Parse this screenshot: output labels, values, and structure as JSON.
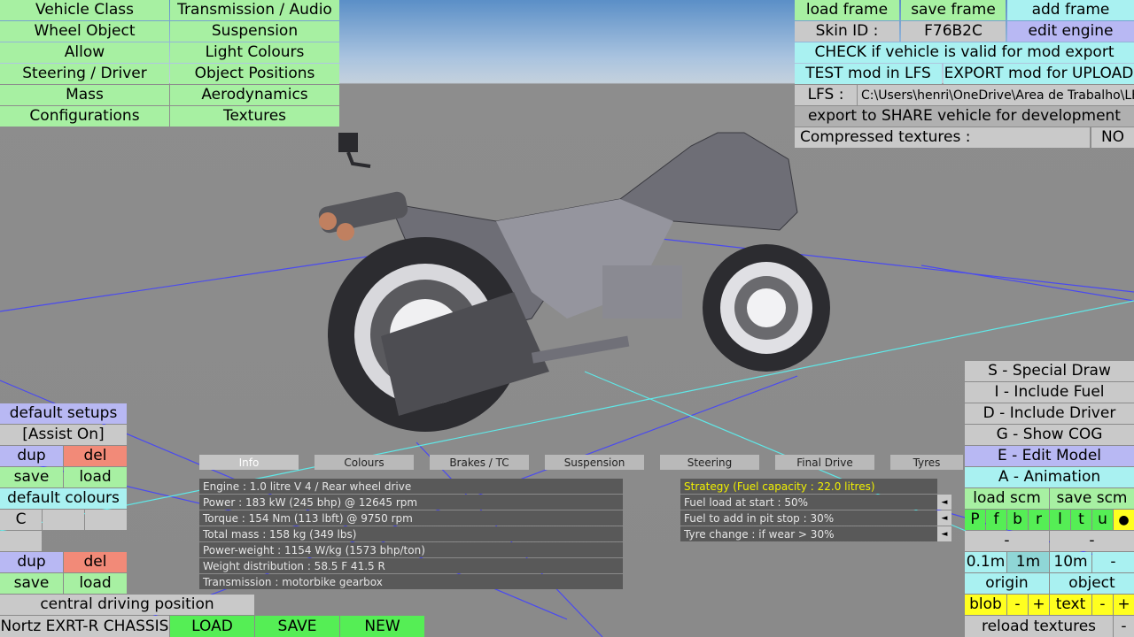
{
  "left_menu": {
    "col1": [
      "Vehicle Class",
      "Wheel Object",
      "Allow",
      "Steering / Driver",
      "Mass",
      "Configurations"
    ],
    "col2": [
      "Transmission / Audio",
      "Suspension",
      "Light Colours",
      "Object Positions",
      "Aerodynamics",
      "Textures"
    ]
  },
  "top_right": {
    "load_frame": "load frame",
    "save_frame": "save frame",
    "add_frame": "add frame",
    "skin_id_label": "Skin ID :",
    "skin_id_value": "F76B2C",
    "edit_engine": "edit engine",
    "check_vehicle": "CHECK if vehicle is valid for mod export",
    "test_mod": "TEST mod in LFS",
    "export_mod": "EXPORT mod for UPLOAD",
    "lfs_label": "LFS :",
    "lfs_path": "C:\\Users\\henri\\OneDrive\\Area de Trabalho\\LFS",
    "export_share": "export to SHARE vehicle for development",
    "compressed_label": "Compressed textures :",
    "compressed_value": "NO"
  },
  "left_bottom": {
    "default_setups": "default setups",
    "assist": "[Assist On]",
    "dup1": "dup",
    "del1": "del",
    "save1": "save",
    "load1": "load",
    "default_colours": "default colours",
    "colour_c": "C",
    "dup2": "dup",
    "del2": "del",
    "save2": "save",
    "load2": "load",
    "central": "central driving position",
    "chassis": "Nortz EXRT-R CHASSIS",
    "load_btn": "LOAD",
    "save_btn": "SAVE",
    "new_btn": "NEW"
  },
  "tabs": [
    "Info",
    "Colours",
    "Brakes / TC",
    "Suspension",
    "Steering",
    "Final Drive",
    "Tyres"
  ],
  "info_lines": [
    "Engine : 1.0 litre V 4 / Rear wheel drive",
    "Power : 183 kW (245 bhp) @ 12645 rpm",
    "Torque : 154 Nm (113 lbft) @ 9750 rpm",
    "Total mass : 158 kg (349 lbs)",
    "Power-weight : 1154 W/kg (1573 bhp/ton)",
    "Weight distribution : 58.5 F  41.5 R",
    "Transmission : motorbike gearbox"
  ],
  "strategy": {
    "title": "Strategy (Fuel capacity : 22.0 litres)",
    "lines": [
      "Fuel load at start : 50%",
      "Fuel to add in pit stop : 30%",
      "Tyre change : if wear > 30%"
    ],
    "arrow": "◄"
  },
  "right_panel": {
    "special_draw": "S - Special Draw",
    "include_fuel": "I - Include Fuel",
    "include_driver": "D - Include Driver",
    "show_cog": "G - Show COG",
    "edit_model": "E - Edit Model",
    "animation": "A - Animation",
    "load_scm": "load scm",
    "save_scm": "save scm",
    "letters": [
      "P",
      "f",
      "b",
      "r",
      "l",
      "t",
      "u"
    ],
    "dot": "●",
    "minus": "-",
    "dist1": "0.1m",
    "dist2": "1m",
    "dist3": "10m",
    "origin": "origin",
    "object": "object",
    "blob": "blob",
    "text": "text",
    "plus": "+",
    "reload_textures": "reload textures"
  }
}
